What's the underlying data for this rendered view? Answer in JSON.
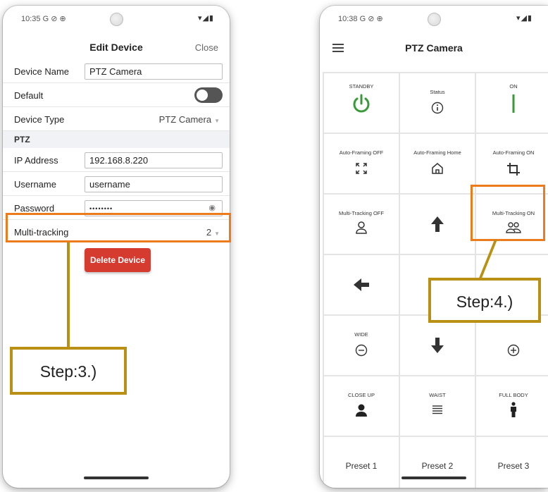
{
  "left_screen": {
    "status_time": "10:35",
    "status_left_icons": "G ⊘ ⊕",
    "status_right_icons": "▾◢▮",
    "title": "Edit Device",
    "close_label": "Close",
    "fields": {
      "device_name": {
        "label": "Device Name",
        "value": "PTZ Camera"
      },
      "default": {
        "label": "Default",
        "checked": false
      },
      "device_type": {
        "label": "Device Type",
        "value": "PTZ Camera"
      },
      "section_ptz": "PTZ",
      "ip_address": {
        "label": "IP Address",
        "value": "192.168.8.220"
      },
      "username": {
        "label": "Username",
        "value": "username"
      },
      "password": {
        "label": "Password",
        "value": "••••••••"
      },
      "multi_tracking": {
        "label": "Multi-tracking",
        "value": "2"
      }
    },
    "delete_button": "Delete Device"
  },
  "right_screen": {
    "status_time": "10:38",
    "status_left_icons": "G ⊘ ⊕",
    "status_right_icons": "▾◢▮",
    "title": "PTZ Camera",
    "cells": [
      {
        "label": "STANDBY",
        "icon": "power-icon"
      },
      {
        "label": "Status",
        "icon": "info-icon"
      },
      {
        "label": "ON",
        "icon": "on-bar-icon"
      },
      {
        "label": "Auto-Framing OFF",
        "icon": "expand-icon"
      },
      {
        "label": "Auto-Framing Home",
        "icon": "home-icon"
      },
      {
        "label": "Auto-Framing ON",
        "icon": "crop-icon"
      },
      {
        "label": "Multi-Tracking OFF",
        "icon": "person-outline-icon"
      },
      {
        "label": "",
        "icon": "arrow-up-icon"
      },
      {
        "label": "Multi-Tracking ON",
        "icon": "group-icon"
      },
      {
        "label": "",
        "icon": "arrow-left-icon"
      },
      {
        "label": "",
        "icon": "refresh-icon"
      },
      {
        "label": "",
        "icon": "arrow-right-icon"
      },
      {
        "label": "WIDE",
        "icon": "zoom-out-icon"
      },
      {
        "label": "",
        "icon": "arrow-down-icon"
      },
      {
        "label": "",
        "icon": "zoom-in-icon"
      },
      {
        "label": "CLOSE UP",
        "icon": "person-filled-icon"
      },
      {
        "label": "WAIST",
        "icon": "lines-icon"
      },
      {
        "label": "FULL BODY",
        "icon": "standing-person-icon"
      }
    ],
    "presets": [
      "Preset 1",
      "Preset 2",
      "Preset 3"
    ]
  },
  "annotations": {
    "step3": "Step:3.)",
    "step4": "Step:4.)",
    "highlight_color": "#ec7b1c",
    "callout_color": "#b99014"
  },
  "colors": {
    "delete_red": "#d63b30",
    "standby_green": "#3a9a3a",
    "grid_line": "#e4e4e4"
  }
}
